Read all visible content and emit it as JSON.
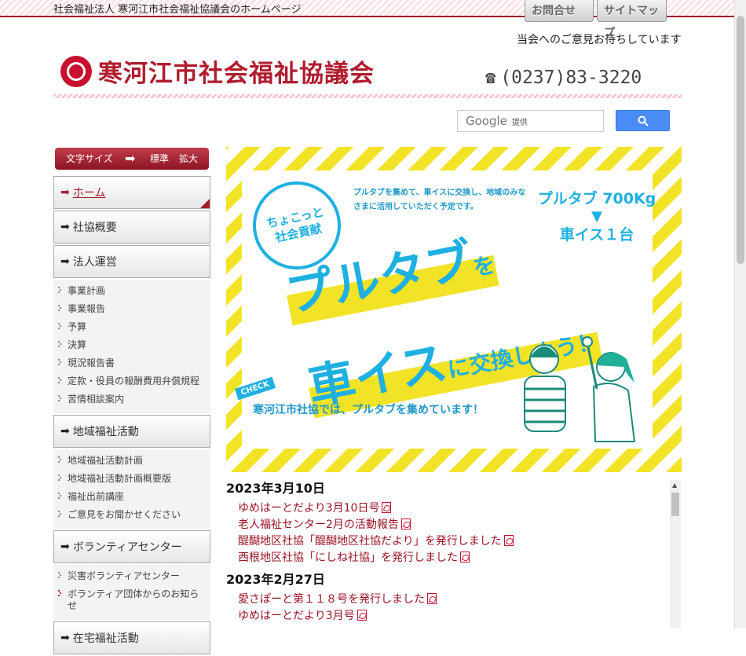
{
  "header": {
    "tagline": "社会福祉法人 寒河江市社会福祉協議会のホームページ",
    "contact_label": "お問合せ",
    "sitemap_label": "サイトマップ",
    "opinion": "当会へのご意見お待ちしています",
    "site_name": "寒河江市社会福祉協議会",
    "phone": "(0237)83-3220"
  },
  "search": {
    "brand": "Google",
    "provided": "提供",
    "button_icon": "search-icon"
  },
  "font_size": {
    "label": "文字サイズ",
    "standard": "標準",
    "large": "拡大"
  },
  "sidebar": {
    "home": "ホーム",
    "about": "社協概要",
    "management": "法人運営",
    "management_items": [
      "事業計画",
      "事業報告",
      "予算",
      "決算",
      "現況報告書",
      "定款・役員の報酬費用弁償規程",
      "苦情相談案内"
    ],
    "community": "地域福祉活動",
    "community_items": [
      "地域福祉活動計画",
      "地域福祉活動計画概要版",
      "福祉出前講座",
      "ご意見をお聞かせください"
    ],
    "volunteer": "ボランティアセンター",
    "volunteer_items": [
      "災害ボランティアセンター",
      "ボランティア団体からのお知らせ"
    ],
    "home_welfare": "在宅福祉活動"
  },
  "banner": {
    "badge_line1": "ちょこっと",
    "badge_line2": "社会貢献",
    "desc": "プルタブを集めて、車イスに交換し、地域のみなさまに活用していただく予定です。",
    "kg": "プルタブ 700Kg",
    "wheelchair": "車イス１台",
    "title1": "プルタブ",
    "title1_suffix": "を",
    "title2": "車イス",
    "title2_suffix": "に交換しよう！",
    "check": "CHECK",
    "bottom": "寒河江市社協では、プルタブを集めています！"
  },
  "news": [
    {
      "date": "2023年3月10日",
      "items": [
        "ゆめはーとだより3月10日号",
        "老人福祉センター2月の活動報告",
        "醍醐地区社協「醍醐地区社協だより」を発行しました",
        "西根地区社協「にしね社協」を発行しました"
      ]
    },
    {
      "date": "2023年2月27日",
      "items": [
        "愛さぽーと第１１８号を発行しました",
        "ゆめはーとだより3月号"
      ]
    }
  ],
  "colors": {
    "brand_red": "#a11d2b",
    "banner_blue": "#1fb0e2",
    "banner_yellow": "#f3e326"
  }
}
